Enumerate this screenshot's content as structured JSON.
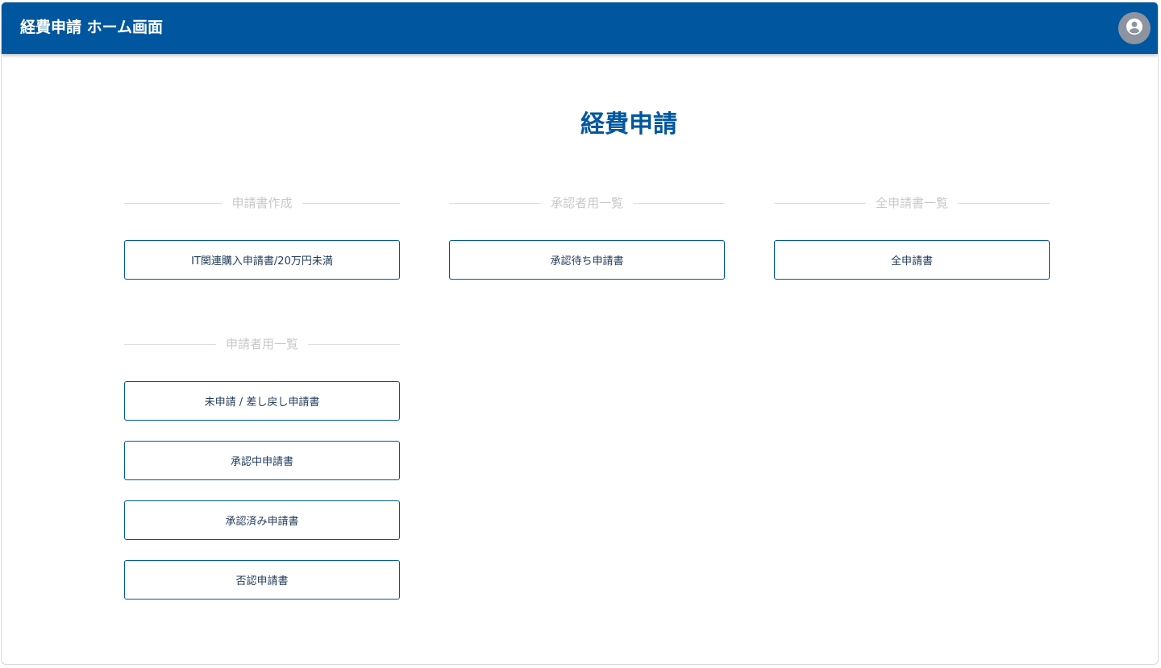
{
  "header": {
    "title": "経費申請 ホーム画面",
    "account_icon": "account-circle-icon",
    "bar_color": "#00579f"
  },
  "main": {
    "title": "経費申請"
  },
  "sections": [
    {
      "label": "申請書作成",
      "buttons": [
        "IT関連購入申請書/20万円未満"
      ]
    },
    {
      "label": "承認者用一覧",
      "buttons": [
        "承認待ち申請書"
      ]
    },
    {
      "label": "全申請書一覧",
      "buttons": [
        "全申請書"
      ]
    },
    {
      "label": "申請者用一覧",
      "buttons": [
        "未申請 / 差し戻し申請書",
        "承認中申請書",
        "承認済み申請書",
        "否認申請書"
      ]
    }
  ]
}
